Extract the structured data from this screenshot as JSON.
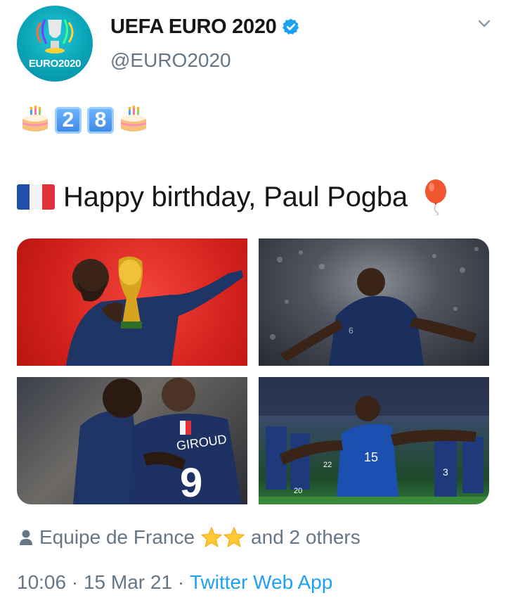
{
  "header": {
    "display_name": "UEFA EURO 2020",
    "handle": "@EURO2020",
    "avatar_text": "EURO2020",
    "verified": true
  },
  "tweet": {
    "emoji_line": {
      "keycaps": [
        "2",
        "8"
      ],
      "icons": [
        "birthday-cake",
        "keycap-2",
        "keycap-8",
        "birthday-cake"
      ]
    },
    "headline": {
      "text": "Happy birthday, Paul Pogba",
      "leading_icon": "france-flag",
      "trailing_icon": "balloon"
    },
    "media": {
      "count": 4,
      "photos": [
        {
          "description_name": "photo-world-cup-trophy"
        },
        {
          "description_name": "photo-celebration-arms-wide"
        },
        {
          "description_name": "photo-embrace-giroud",
          "visible_jersey_text": "GIROUD",
          "visible_number": "9"
        },
        {
          "description_name": "photo-team-celebration",
          "visible_numbers": [
            "15",
            "3",
            "22",
            "20"
          ]
        }
      ]
    }
  },
  "engagement": {
    "liked_by_name": "Equipe de France",
    "liked_by_stars": 2,
    "others_text": "and 2 others"
  },
  "meta": {
    "time": "10:06",
    "separator": " · ",
    "date": "15 Mar 21",
    "source": "Twitter Web App"
  },
  "colors": {
    "text_primary": "#14171a",
    "text_secondary": "#657786",
    "link": "#1da1f2",
    "verified": "#1da1f2",
    "avatar_bg": "#0aa4b7"
  }
}
